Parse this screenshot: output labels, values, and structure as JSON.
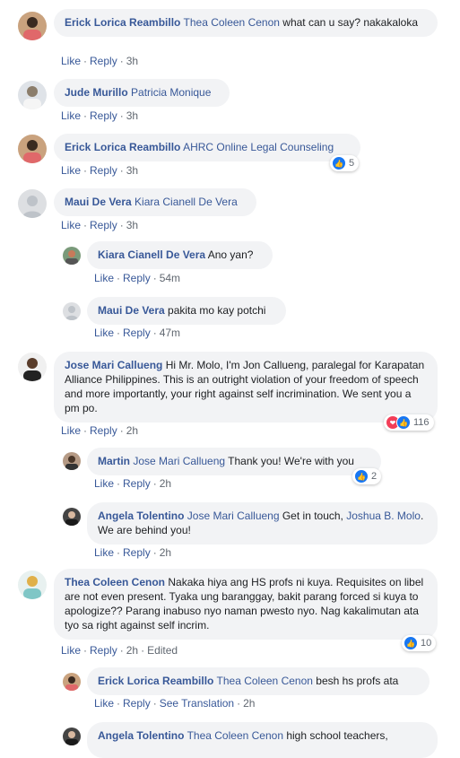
{
  "labels": {
    "like": "Like",
    "reply": "Reply",
    "edited": "Edited",
    "see_translation": "See Translation"
  },
  "colors": {
    "name": "#385898",
    "bubble": "#f2f3f5",
    "meta": "#606770",
    "like_blue": "#1877f2",
    "love_red": "#f33e58"
  },
  "comments": [
    {
      "author": "Erick Lorica Reambillo",
      "tag": "Thea Coleen Cenon",
      "text": " what can u say? nakakaloka",
      "time": "3h"
    },
    {
      "author": "Jude Murillo",
      "tag": "Patricia Monique",
      "text": "",
      "time": "3h"
    },
    {
      "author": "Erick Lorica Reambillo",
      "tag": "AHRC Online Legal Counseling",
      "text": "",
      "time": "3h",
      "reaction_count": "5"
    },
    {
      "author": "Maui De Vera",
      "tag": "Kiara Cianell De Vera",
      "text": "",
      "time": "3h"
    },
    {
      "author": "Kiara Cianell De Vera",
      "tag": "",
      "text": " Ano yan?",
      "time": "54m"
    },
    {
      "author": "Maui De Vera",
      "tag": "",
      "text": " pakita mo kay potchi",
      "time": "47m"
    },
    {
      "author": "Jose Mari Callueng",
      "tag": "",
      "text": " Hi Mr. Molo, I'm Jon Callueng, paralegal for Karapatan Alliance Philippines. This is an outright violation of your freedom of speech and more importantly, your right against self incrimination. We sent you a pm po.",
      "time": "2h",
      "reaction_count": "116"
    },
    {
      "author": "Martin",
      "tag": "Jose Mari Callueng",
      "text": " Thank you! We're with you",
      "time": "2h",
      "reaction_count": "2"
    },
    {
      "author": "Angela Tolentino",
      "tag": "Jose Mari Callueng",
      "text": " Get in touch, ",
      "tag2": "Joshua B. Molo",
      "text2": ". We are behind you!",
      "time": "2h"
    },
    {
      "author": "Thea Coleen Cenon",
      "tag": "",
      "text": " Nakaka hiya ang HS profs ni kuya. Requisites on libel are not even present. Tyaka ung baranggay, bakit parang forced si kuya to apologize?? Parang inabuso nyo naman pwesto nyo. Nag kakalimutan ata tyo sa right against self incrim.",
      "time": "2h",
      "reaction_count": "10"
    },
    {
      "author": "Erick Lorica Reambillo",
      "tag": "Thea Coleen Cenon",
      "text": " besh hs profs ata",
      "time": "2h"
    },
    {
      "author": "Angela Tolentino",
      "tag": "Thea Coleen Cenon",
      "text": " high school teachers,",
      "time": ""
    }
  ]
}
